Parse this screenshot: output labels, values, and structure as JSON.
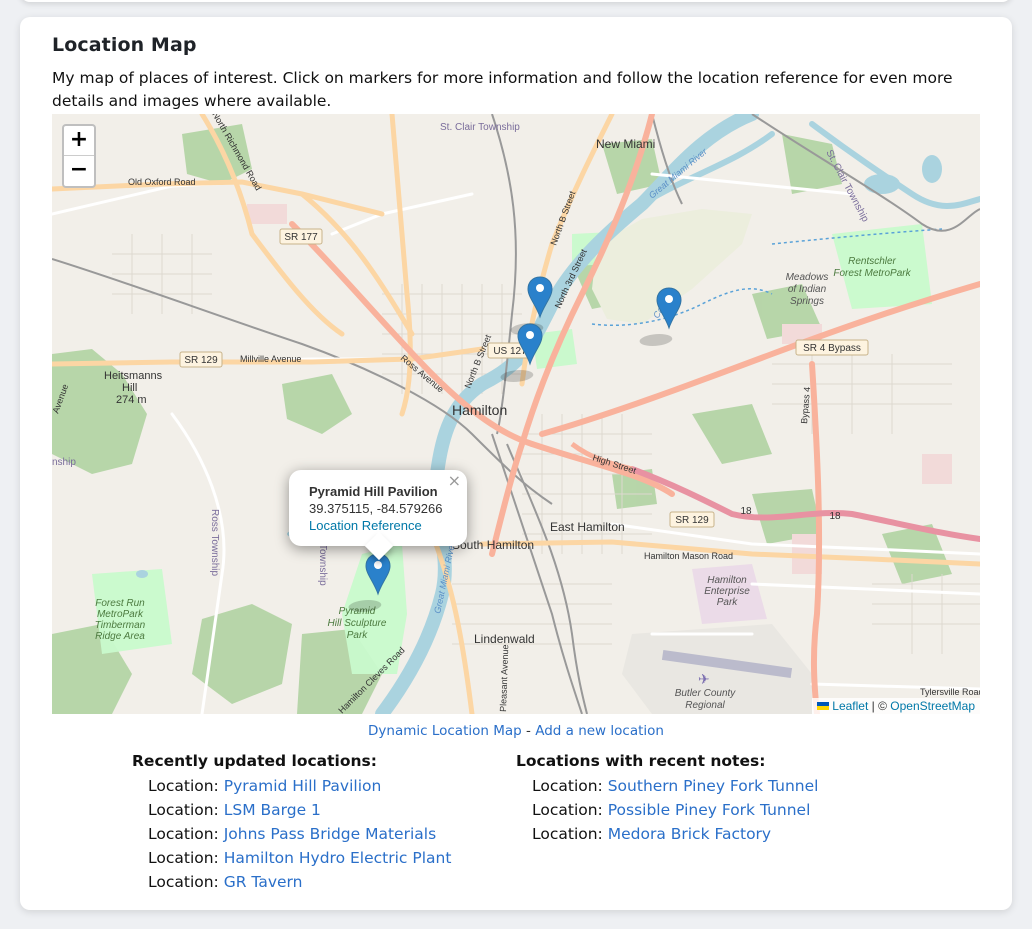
{
  "card": {
    "title": "Location Map",
    "description": "My map of places of interest. Click on markers for more information and follow the location reference for even more details and images where available."
  },
  "map": {
    "zoom_in": "+",
    "zoom_out": "−",
    "labels": {
      "st_clair_township": "St. Clair Township",
      "new_miami": "New Miami",
      "old_oxford_road": "Old Oxford Road",
      "sr177": "SR 177",
      "sr129_west": "SR 129",
      "millville_avenue": "Millville Avenue",
      "heitsmanns_hill": "Heitsmanns",
      "heitsmanns_hill2": "Hill",
      "heitsmanns_hill3": "274 m",
      "ross_avenue": "Ross Avenue",
      "north_b_street": "North B Street",
      "north_3rd_street": "North 3rd Street",
      "north_b_street_upper": "North B Street",
      "us127": "US 127",
      "hamilton": "Hamilton",
      "rentschler": "Rentschler",
      "rentschler2": "Forest MetroPark",
      "meadows": "Meadows",
      "meadows2": "of Indian",
      "meadows3": "Springs",
      "sr4_bypass": "SR 4 Bypass",
      "bypass4": "Bypass 4",
      "high_street": "High Street",
      "sr129_east": "SR 129",
      "route18a": "18",
      "route18b": "18",
      "east_hamilton": "East Hamilton",
      "south_hamilton": "South Hamilton",
      "hamilton_mason_road": "Hamilton Mason Road",
      "hamilton_enterprise": "Hamilton",
      "hamilton_enterprise2": "Enterprise",
      "hamilton_enterprise3": "Park",
      "ross_township": "Ross Township",
      "township": "Township",
      "forest_run": "Forest Run",
      "forest_run2": "MetroPark",
      "forest_run3": "Timberman",
      "forest_run4": "Ridge Area",
      "pyramid_hill": "Pyramid",
      "pyramid_hill2": "Hill Sculpture",
      "pyramid_hill3": "Park",
      "lindenwald": "Lindenwald",
      "pleasant_avenue": "Pleasant Avenue",
      "butler_county": "Butler County",
      "butler_county2": "Regional",
      "tylersville_road": "Tylersville Road",
      "hamilton_cleves_road": "Hamilton Cleves Road",
      "great_miami_river": "Great Miami River",
      "great_miami_river2": "Great Miami River",
      "st_clair_township_side": "St. Clair Township",
      "ross_township_left": "nship",
      "ross_avenue_left": "Avenue",
      "north_richmond_road": "North Richmond Road",
      "green_channel": "Canal"
    },
    "popup": {
      "title": "Pyramid Hill Pavilion",
      "coords": "39.375115, -84.579266",
      "link": "Location Reference",
      "close": "×"
    },
    "attribution": {
      "leaflet": "Leaflet",
      "separator": "| ©",
      "osm": "OpenStreetMap"
    }
  },
  "links": {
    "dynamic_map": "Dynamic Location Map",
    "separator": " - ",
    "add_location": "Add a new location"
  },
  "recent_updates": {
    "heading": "Recently updated locations:",
    "prefix": "Location: ",
    "items": [
      "Pyramid Hill Pavilion",
      "LSM Barge 1",
      "Johns Pass Bridge Materials",
      "Hamilton Hydro Electric Plant",
      "GR Tavern"
    ]
  },
  "recent_notes": {
    "heading": "Locations with recent notes:",
    "prefix": "Location: ",
    "items": [
      "Southern Piney Fork Tunnel",
      "Possible Piney Fork Tunnel",
      "Medora Brick Factory"
    ]
  },
  "colors": {
    "accent_link": "#2a6fc9",
    "marker": "#2a81cb",
    "map_bg": "#f2efe9",
    "river": "#aad3df",
    "park": "#c8facc",
    "forest": "#add19e",
    "major_road": "#fcd6a4",
    "trunk": "#f9b29c",
    "pink_road": "#e892a2"
  }
}
